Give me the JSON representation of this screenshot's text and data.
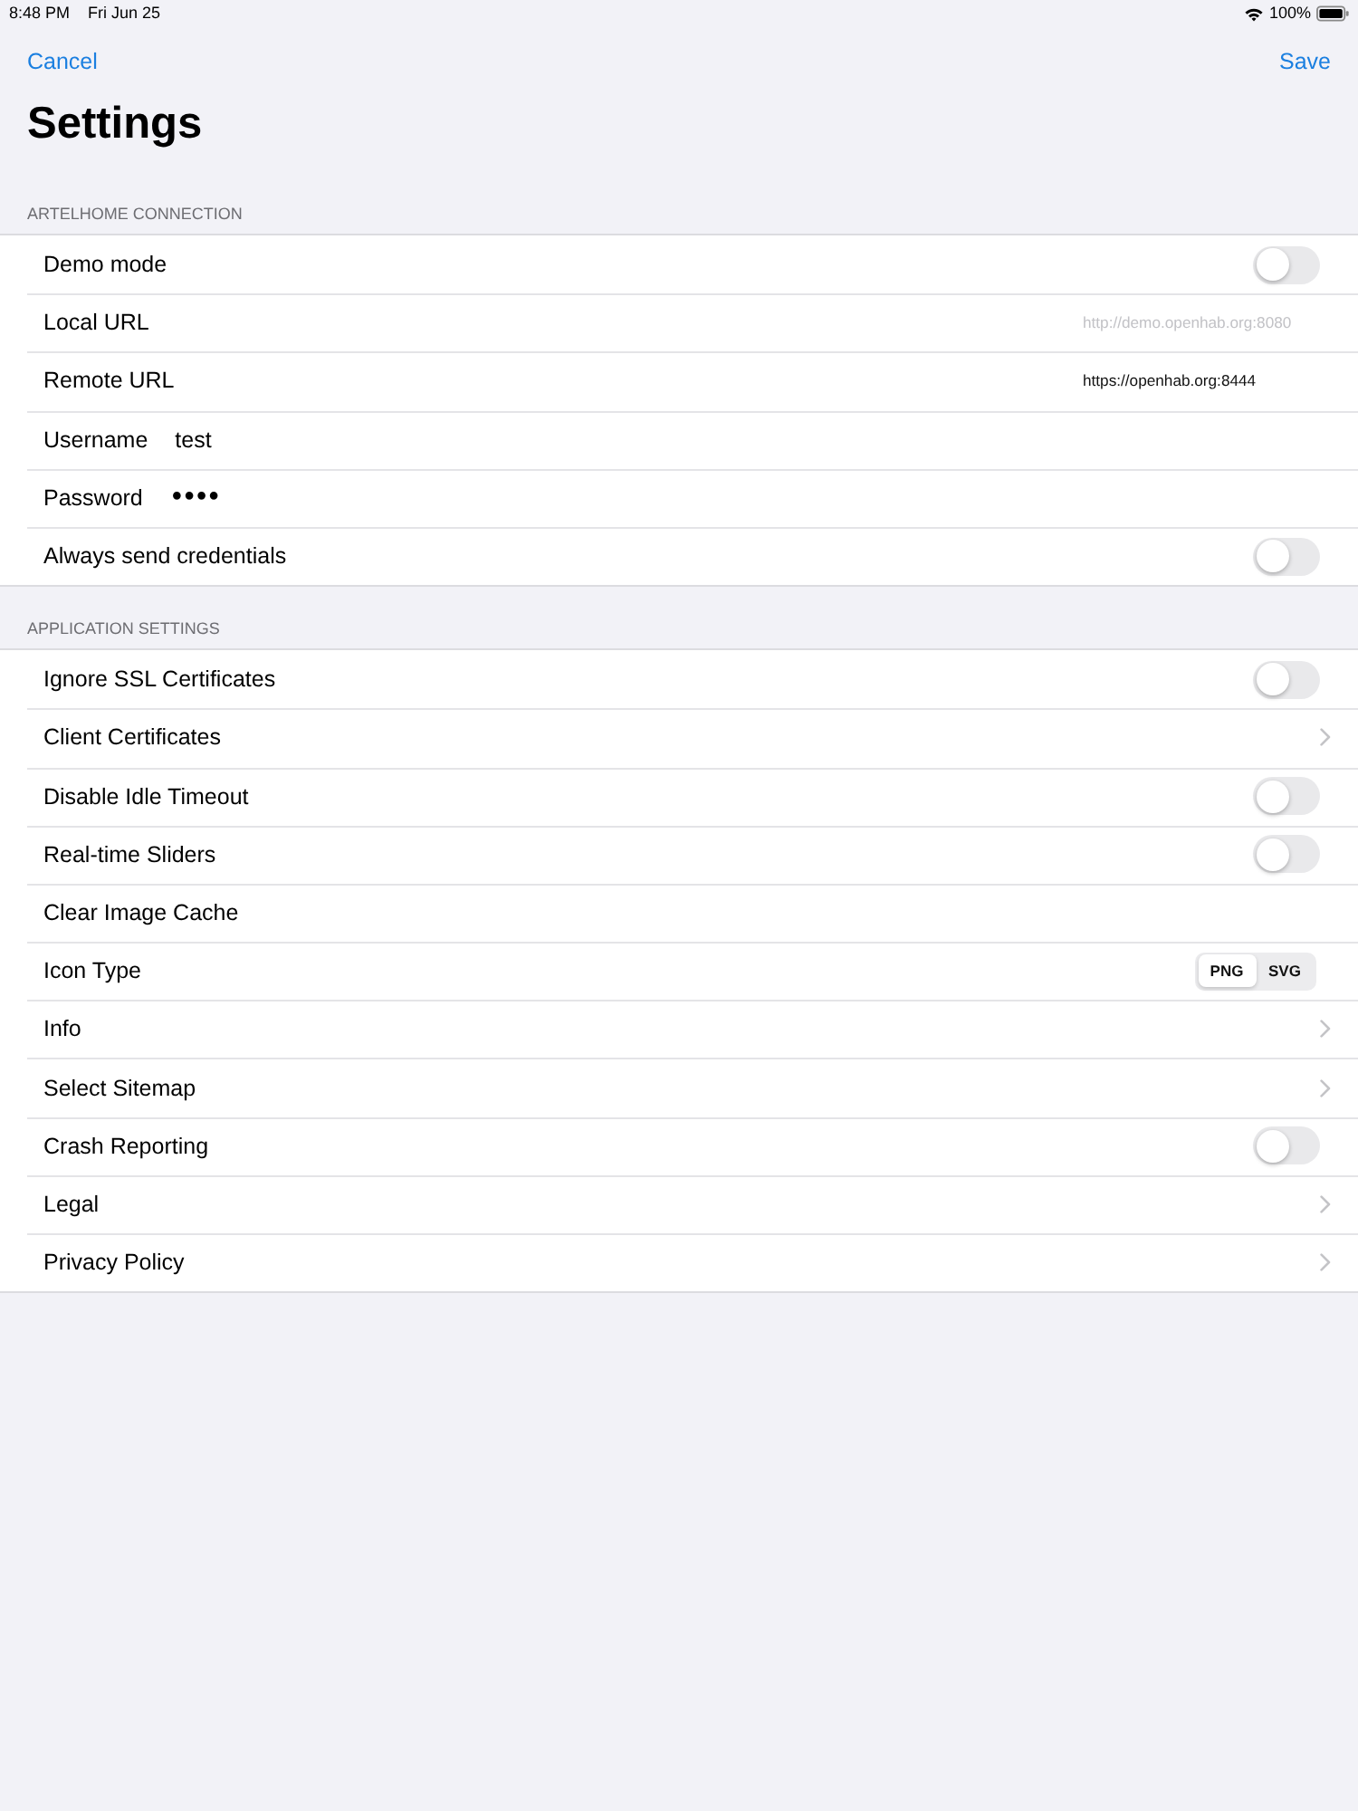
{
  "status_bar": {
    "time": "8:48 PM",
    "date": "Fri Jun 25",
    "battery": "100%"
  },
  "nav": {
    "cancel": "Cancel",
    "save": "Save"
  },
  "title": "Settings",
  "sections": [
    {
      "header": "ARTELHOME CONNECTION",
      "rows": [
        {
          "kind": "toggle",
          "label": "Demo mode",
          "on": false
        },
        {
          "kind": "field",
          "label": "Local URL",
          "placeholder": "http://demo.openhab.org:8080"
        },
        {
          "kind": "field",
          "label": "Remote URL",
          "value": "https://openhab.org:8444"
        },
        {
          "kind": "inline_field",
          "label": "Username",
          "value": "test"
        },
        {
          "kind": "secure_field",
          "label": "Password",
          "value": "••••"
        },
        {
          "kind": "toggle",
          "label": "Always send credentials",
          "on": false
        }
      ]
    },
    {
      "header": "APPLICATION SETTINGS",
      "rows": [
        {
          "kind": "toggle",
          "label": "Ignore SSL Certificates",
          "on": false
        },
        {
          "kind": "link",
          "label": "Client Certificates"
        },
        {
          "kind": "toggle",
          "label": "Disable Idle Timeout",
          "on": false
        },
        {
          "kind": "toggle",
          "label": "Real-time Sliders",
          "on": false
        },
        {
          "kind": "action",
          "label": "Clear Image Cache"
        },
        {
          "kind": "segmented",
          "label": "Icon Type",
          "options": [
            {
              "label": "PNG",
              "selected": true
            },
            {
              "label": "SVG",
              "selected": false
            }
          ]
        },
        {
          "kind": "link",
          "label": "Info"
        },
        {
          "kind": "link",
          "label": "Select Sitemap"
        },
        {
          "kind": "toggle",
          "label": "Crash Reporting",
          "on": false
        },
        {
          "kind": "link",
          "label": "Legal"
        },
        {
          "kind": "link",
          "label": "Privacy Policy"
        }
      ]
    }
  ]
}
